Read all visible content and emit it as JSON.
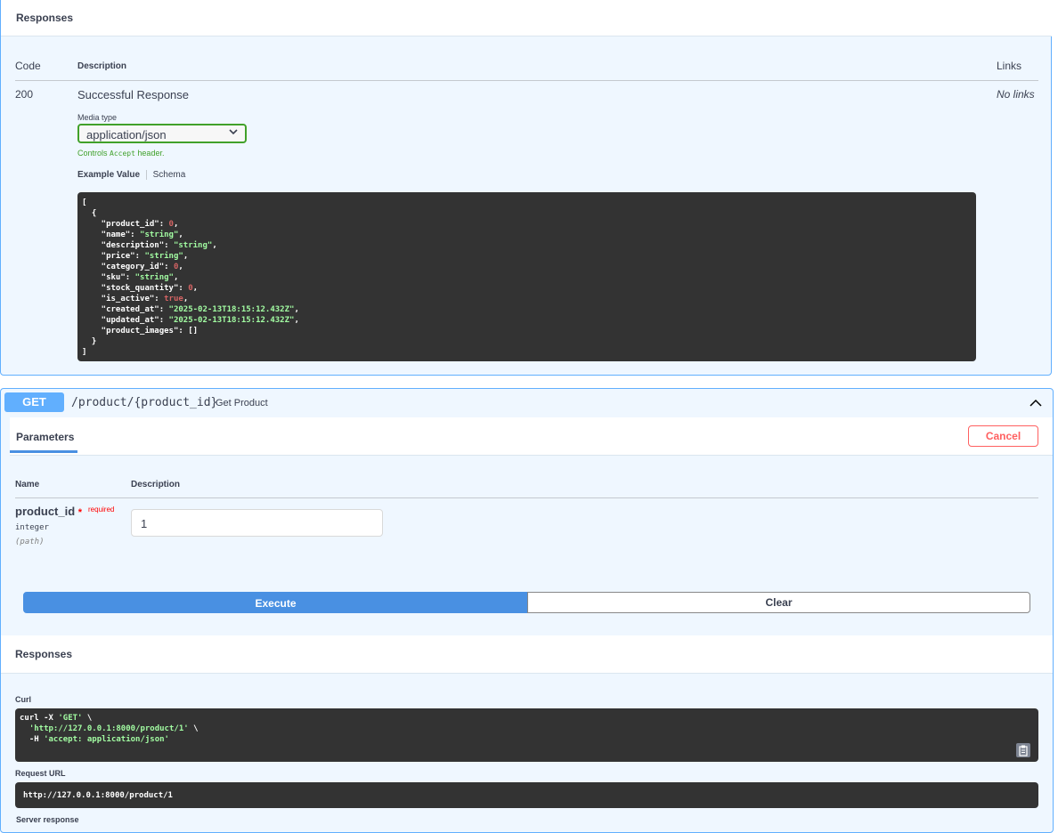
{
  "top_responses": {
    "title": "Responses",
    "col_code": "Code",
    "col_description": "Description",
    "col_links": "Links",
    "row": {
      "code": "200",
      "description": "Successful Response",
      "links": "No links"
    },
    "media_type_label": "Media type",
    "media_type_value": "application/json",
    "controls_prefix": "Controls ",
    "controls_code": "Accept",
    "controls_suffix": " header.",
    "tab_example": "Example Value",
    "tab_schema": "Schema",
    "example_json": [
      {
        "t": "["
      },
      {
        "t": "  {"
      },
      {
        "k": "    \"product_id\": ",
        "v": "0",
        "vt": "num",
        "e": ","
      },
      {
        "k": "    \"name\": ",
        "v": "\"string\"",
        "vt": "str",
        "e": ","
      },
      {
        "k": "    \"description\": ",
        "v": "\"string\"",
        "vt": "str",
        "e": ","
      },
      {
        "k": "    \"price\": ",
        "v": "\"string\"",
        "vt": "str",
        "e": ","
      },
      {
        "k": "    \"category_id\": ",
        "v": "0",
        "vt": "num",
        "e": ","
      },
      {
        "k": "    \"sku\": ",
        "v": "\"string\"",
        "vt": "str",
        "e": ","
      },
      {
        "k": "    \"stock_quantity\": ",
        "v": "0",
        "vt": "num",
        "e": ","
      },
      {
        "k": "    \"is_active\": ",
        "v": "true",
        "vt": "num",
        "e": ","
      },
      {
        "k": "    \"created_at\": ",
        "v": "\"2025-02-13T18:15:12.432Z\"",
        "vt": "str",
        "e": ","
      },
      {
        "k": "    \"updated_at\": ",
        "v": "\"2025-02-13T18:15:12.432Z\"",
        "vt": "str",
        "e": ","
      },
      {
        "t": "    \"product_images\": []"
      },
      {
        "t": "  }"
      },
      {
        "t": "]"
      }
    ]
  },
  "get_op": {
    "method": "GET",
    "path": "/product/{product_id}",
    "summary": "Get Product",
    "collapse_icon": "chevron-up-icon",
    "parameters_tab": "Parameters",
    "cancel_label": "Cancel",
    "col_name": "Name",
    "col_description": "Description",
    "param": {
      "name": "product_id",
      "required_star": "*",
      "required_label": "required",
      "type": "integer",
      "location": "(path)",
      "value": "1"
    },
    "execute_label": "Execute",
    "clear_label": "Clear",
    "responses_title": "Responses",
    "curl_label": "Curl",
    "curl_lines": [
      {
        "a": "curl -X ",
        "s": "'GET'",
        "b": " \\"
      },
      {
        "a": "  ",
        "s": "'http://127.0.0.1:8000/product/1'",
        "b": " \\"
      },
      {
        "a": "  -H ",
        "s": "'accept: application/json'",
        "b": ""
      }
    ],
    "copy_icon": "clipboard-icon",
    "request_url_label": "Request URL",
    "request_url": "http://127.0.0.1:8000/product/1",
    "server_response_label": "Server response"
  },
  "colors": {
    "get_blue": "#61affe",
    "execute_blue": "#4990e2",
    "cancel_red": "#ff6060",
    "select_green": "#41a12a",
    "code_bg": "#333333"
  }
}
